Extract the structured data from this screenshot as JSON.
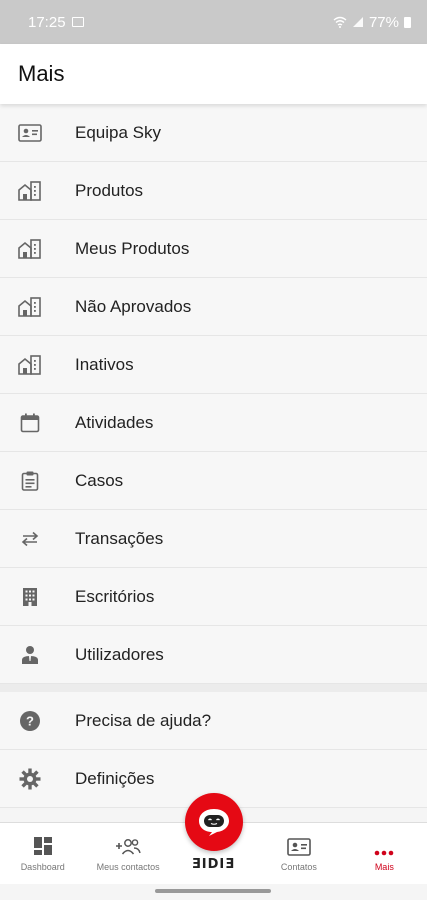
{
  "status_bar": {
    "time": "17:25",
    "battery": "77%"
  },
  "header": {
    "title": "Mais"
  },
  "menu": [
    {
      "label": "Equipa Sky",
      "icon": "contact-card-icon"
    },
    {
      "label": "Produtos",
      "icon": "building-icon"
    },
    {
      "label": "Meus Produtos",
      "icon": "building-icon"
    },
    {
      "label": "Não Aprovados",
      "icon": "building-icon"
    },
    {
      "label": "Inativos",
      "icon": "building-icon"
    },
    {
      "label": "Atividades",
      "icon": "calendar-icon"
    },
    {
      "label": "Casos",
      "icon": "clipboard-icon"
    },
    {
      "label": "Transações",
      "icon": "swap-arrows-icon"
    },
    {
      "label": "Escritórios",
      "icon": "office-building-icon"
    },
    {
      "label": "Utilizadores",
      "icon": "user-icon"
    }
  ],
  "support": [
    {
      "label": "Precisa de ajuda?",
      "icon": "help-circle-icon"
    },
    {
      "label": "Definições",
      "icon": "gear-icon"
    }
  ],
  "bottom_nav": {
    "dashboard": "Dashboard",
    "contacts_mine": "Meus contactos",
    "brand": "ƎIDIƎ",
    "contacts": "Contatos",
    "more": "Mais"
  },
  "colors": {
    "accent": "#d0021b",
    "fab": "#e50914"
  }
}
